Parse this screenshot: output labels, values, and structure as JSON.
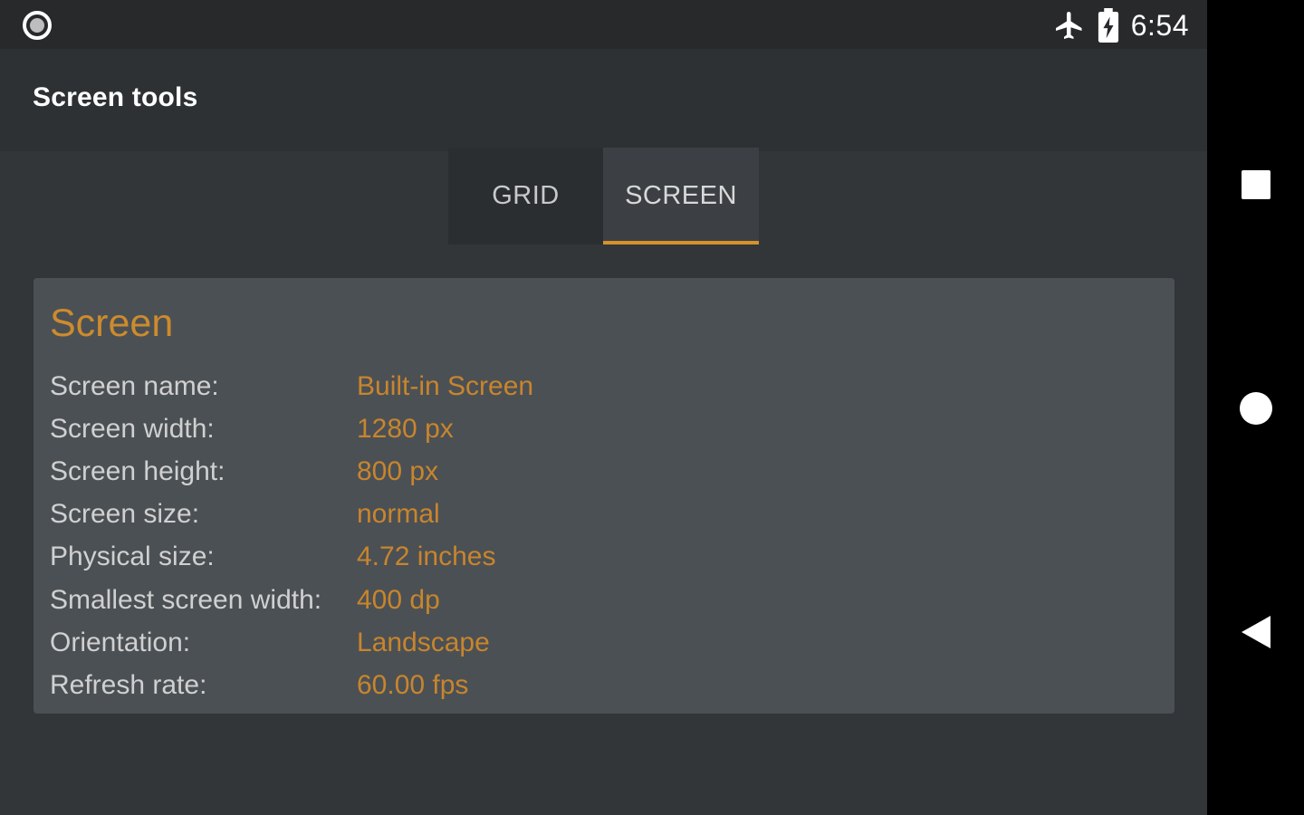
{
  "status_bar": {
    "time": "6:54",
    "icons": [
      "notification-dot-icon",
      "airplane-icon",
      "battery-charging-icon"
    ]
  },
  "app_bar": {
    "title": "Screen tools"
  },
  "tabs": [
    {
      "label": "GRID",
      "selected": false
    },
    {
      "label": "SCREEN",
      "selected": true
    }
  ],
  "card": {
    "title": "Screen",
    "rows": [
      {
        "label": "Screen name:",
        "value": "Built-in Screen"
      },
      {
        "label": "Screen width:",
        "value": "1280 px"
      },
      {
        "label": "Screen height:",
        "value": "800 px"
      },
      {
        "label": "Screen size:",
        "value": "normal"
      },
      {
        "label": "Physical size:",
        "value": "4.72 inches"
      },
      {
        "label": "Smallest screen width:",
        "value": "400 dp"
      },
      {
        "label": "Orientation:",
        "value": "Landscape"
      },
      {
        "label": "Refresh rate:",
        "value": "60.00 fps"
      }
    ]
  },
  "nav_bar": {
    "buttons": [
      "recents-square-icon",
      "home-circle-icon",
      "back-triangle-icon"
    ]
  },
  "colors": {
    "accent": "#cd8b2d",
    "background": "#323639",
    "card": "#4b5054",
    "status_bar": "#27292b",
    "nav_bar": "#000000"
  }
}
